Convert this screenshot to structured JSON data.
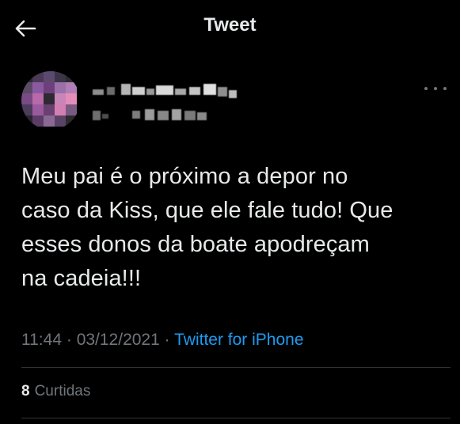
{
  "header": {
    "title": "Tweet",
    "back_icon": "arrow-left-icon"
  },
  "tweet": {
    "text": "Meu pai é o próximo a depor no\ncaso da Kiss, que ele fale tudo! Que\nesses donos da boate apodreçam\nna cadeia!!!",
    "time": "11:44",
    "separator": "·",
    "date": "03/12/2021",
    "source": "Twitter for iPhone",
    "more_icon": "more-options-icon"
  },
  "stats": {
    "likes_count": "8",
    "likes_label": "Curtidas"
  },
  "colors": {
    "background": "#000000",
    "text": "#e7e9ea",
    "secondary": "#71767b",
    "link": "#1d9bf0",
    "divider": "#2f3336"
  }
}
